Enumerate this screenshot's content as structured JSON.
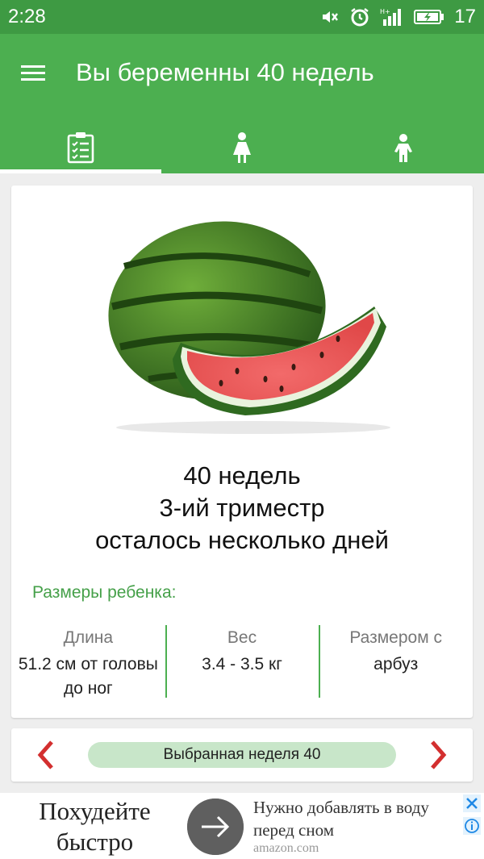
{
  "status_bar": {
    "time": "2:28",
    "battery_level": "17"
  },
  "app_bar": {
    "title": "Вы беременны 40 недель",
    "tabs": [
      "checklist-icon",
      "pregnant-woman-icon",
      "child-icon"
    ],
    "active_tab": 0
  },
  "card": {
    "fruit_icon": "watermelon-image",
    "week_line": "40 недель",
    "trimester_line": "3-ий триместр",
    "remaining_line": "осталось несколько дней",
    "sizes_label": "Размеры ребенка:",
    "stats": [
      {
        "label": "Длина",
        "value": "51.2 см от головы до ног"
      },
      {
        "label": "Вес",
        "value": "3.4 - 3.5 кг"
      },
      {
        "label": "Размером с",
        "value": "арбуз"
      }
    ]
  },
  "week_nav": {
    "selected_label": "Выбранная неделя 40"
  },
  "ad": {
    "headline": "Похудейте быстро",
    "text": "Нужно добавлять в воду перед сном",
    "domain": "amazon.com"
  },
  "colors": {
    "status_bar": "#3e9a43",
    "app_bar": "#4caf50",
    "accent_red": "#d32f2f",
    "pill": "#c8e6c9"
  }
}
